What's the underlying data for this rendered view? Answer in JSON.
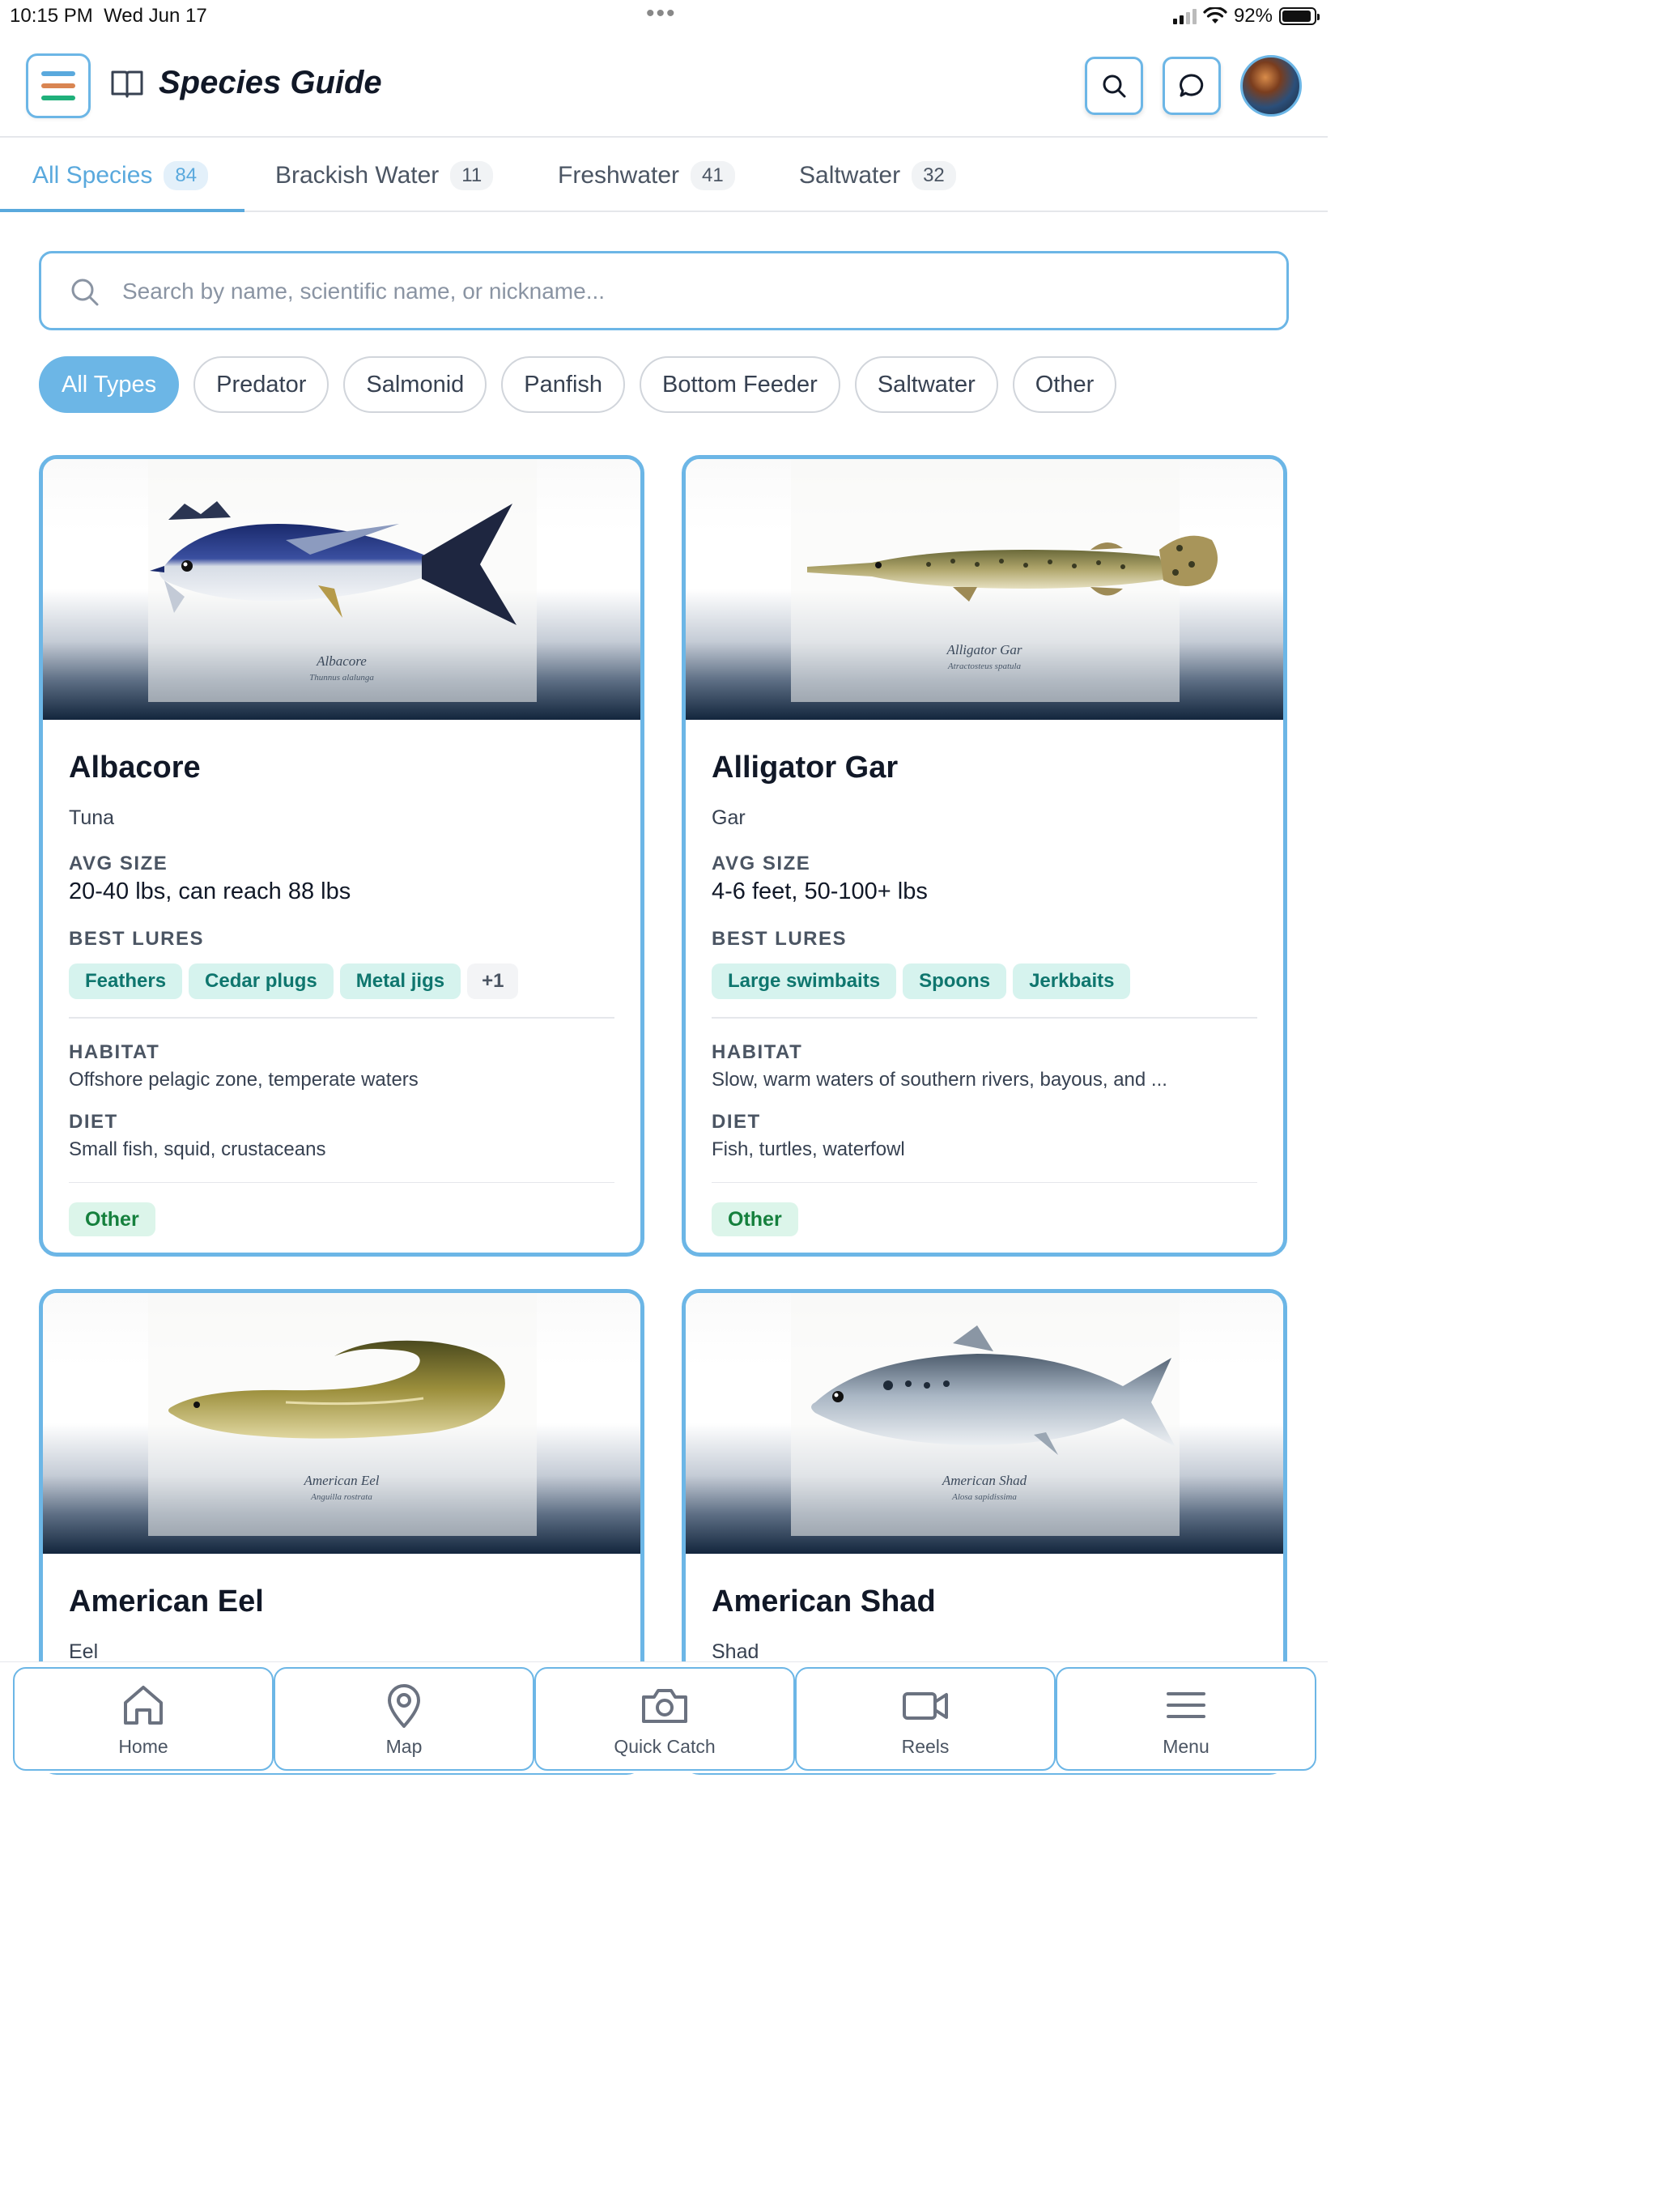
{
  "status_bar": {
    "time": "10:15 PM",
    "date": "Wed Jun 17",
    "battery": "92%",
    "battery_level": 0.92
  },
  "header": {
    "title": "Species Guide",
    "menu_icon": "hamburger-icon",
    "book_icon": "open-book-icon",
    "search_icon": "search-icon",
    "chat_icon": "chat-bubble-icon"
  },
  "colors": {
    "accent": "#6cb6e6",
    "accent_text": "#5aa9dd",
    "lure_bg": "#d6f3ee",
    "lure_text": "#0f766e",
    "category_bg": "#dcf5ea",
    "category_text": "#15803d",
    "menu_bar_top": "#5aa9dd",
    "menu_bar_mid": "#d98552",
    "menu_bar_bottom": "#1fb07a"
  },
  "tabs": [
    {
      "label": "All Species",
      "count": "84",
      "active": true
    },
    {
      "label": "Brackish Water",
      "count": "11",
      "active": false
    },
    {
      "label": "Freshwater",
      "count": "41",
      "active": false
    },
    {
      "label": "Saltwater",
      "count": "32",
      "active": false
    }
  ],
  "search": {
    "placeholder": "Search by name, scientific name, or nickname...",
    "value": ""
  },
  "filters": [
    "All Types",
    "Predator",
    "Salmonid",
    "Panfish",
    "Bottom Feeder",
    "Saltwater",
    "Other"
  ],
  "active_filter": "All Types",
  "labels": {
    "avg_size": "AVG SIZE",
    "best_lures": "BEST LURES",
    "habitat": "HABITAT",
    "diet": "DIET"
  },
  "species": [
    {
      "name": "Albacore",
      "family": "Tuna",
      "avg_size": "20-40 lbs, can reach 88 lbs",
      "lures": [
        "Feathers",
        "Cedar plugs",
        "Metal jigs"
      ],
      "more_lures": "+1",
      "habitat": "Offshore pelagic zone, temperate waters",
      "diet": "Small fish, squid, crustaceans",
      "category": "Other",
      "caption": "Albacore",
      "caption_sci": "Thunnus alalunga"
    },
    {
      "name": "Alligator Gar",
      "family": "Gar",
      "avg_size": "4-6 feet, 50-100+ lbs",
      "lures": [
        "Large swimbaits",
        "Spoons",
        "Jerkbaits"
      ],
      "more_lures": "",
      "habitat": "Slow, warm waters of southern rivers, bayous, and ...",
      "diet": "Fish, turtles, waterfowl",
      "category": "Other",
      "caption": "Alligator Gar",
      "caption_sci": "Atractosteus spatula"
    },
    {
      "name": "American Eel",
      "family": "Eel",
      "caption": "American Eel",
      "caption_sci": "Anguilla rostrata"
    },
    {
      "name": "American Shad",
      "family": "Shad",
      "caption": "American Shad",
      "caption_sci": "Alosa sapidissima"
    }
  ],
  "bottom_nav": [
    {
      "label": "Home",
      "icon": "home-icon"
    },
    {
      "label": "Map",
      "icon": "map-pin-icon"
    },
    {
      "label": "Quick Catch",
      "icon": "camera-icon"
    },
    {
      "label": "Reels",
      "icon": "video-camera-icon"
    },
    {
      "label": "Menu",
      "icon": "menu-icon"
    }
  ]
}
